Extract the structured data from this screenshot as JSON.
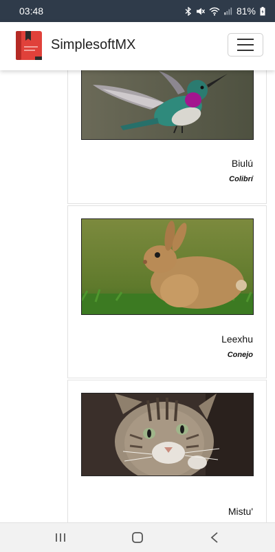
{
  "status_bar": {
    "time": "03:48",
    "battery": "81%",
    "icons": [
      "bluetooth-icon",
      "mute-icon",
      "wifi-icon",
      "signal-icon",
      "battery-icon"
    ]
  },
  "app_bar": {
    "title": "SimplesoftMX",
    "logo_icon": "red-book-icon",
    "menu_icon": "hamburger-icon"
  },
  "cards": [
    {
      "name": "Biulú",
      "translation": "Colibrí",
      "image": "hummingbird"
    },
    {
      "name": "Leexhu",
      "translation": "Conejo",
      "image": "rabbit"
    },
    {
      "name": "Mistu'",
      "translation": "",
      "image": "cat"
    }
  ],
  "nav_bar": {
    "items": [
      "recent-apps-icon",
      "home-icon",
      "back-icon"
    ]
  },
  "colors": {
    "status_bar_bg": "#2f3b4a",
    "logo_red": "#e0413a",
    "nav_bg": "#f2f2f2"
  }
}
